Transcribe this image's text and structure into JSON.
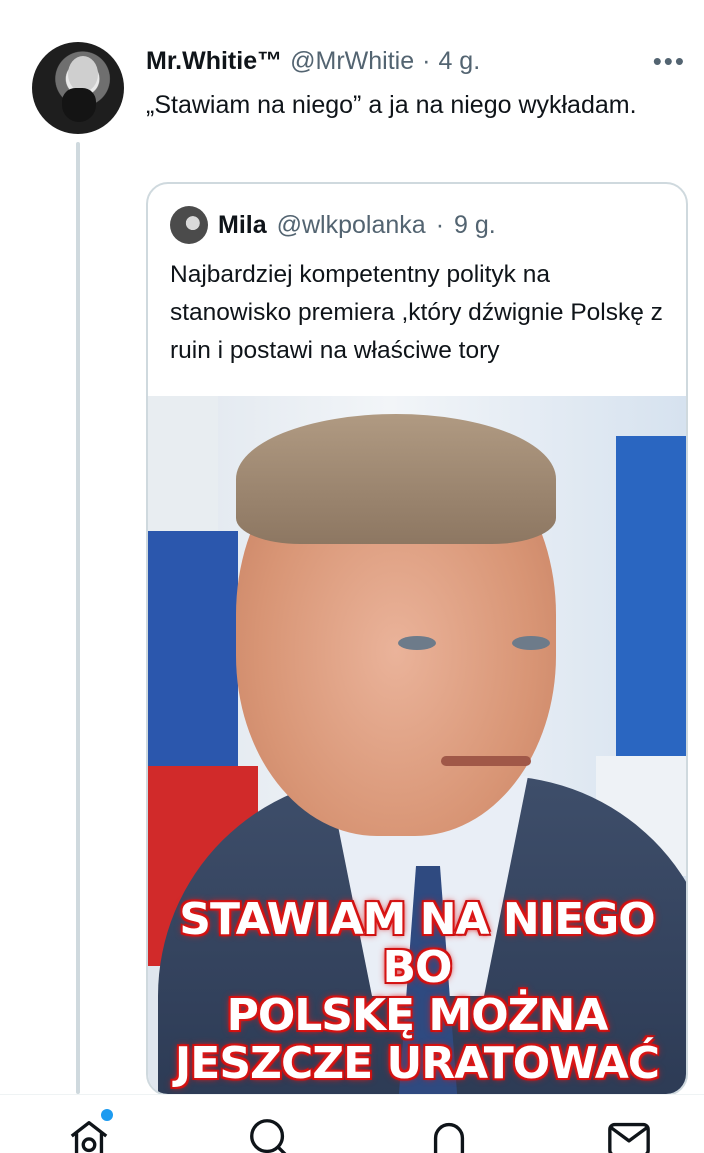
{
  "tweet": {
    "display_name": "Mr.Whitie™",
    "handle": "@MrWhitie",
    "separator": "·",
    "time": "4 g.",
    "more_icon": "more-horizontal-icon",
    "text": "„Stawiam na niego” a ja na niego wykładam."
  },
  "quote": {
    "display_name": "Mila",
    "handle": "@wlkpolanka",
    "separator": "·",
    "time": "9 g.",
    "text": "Najbardziej kompetentny polityk na stanowisko premiera ,który dźwignie Polskę z ruin i postawi na właściwe tory",
    "image_caption": {
      "line1": "STAWIAM NA NIEGO BO",
      "line2": "POLSKĘ MOŻNA",
      "line3": "JESZCZE URATOWAĆ"
    }
  },
  "nav": {
    "items": [
      "home-icon",
      "search-icon",
      "notifications-icon",
      "messages-icon"
    ],
    "accent": "#1d9bf0"
  }
}
